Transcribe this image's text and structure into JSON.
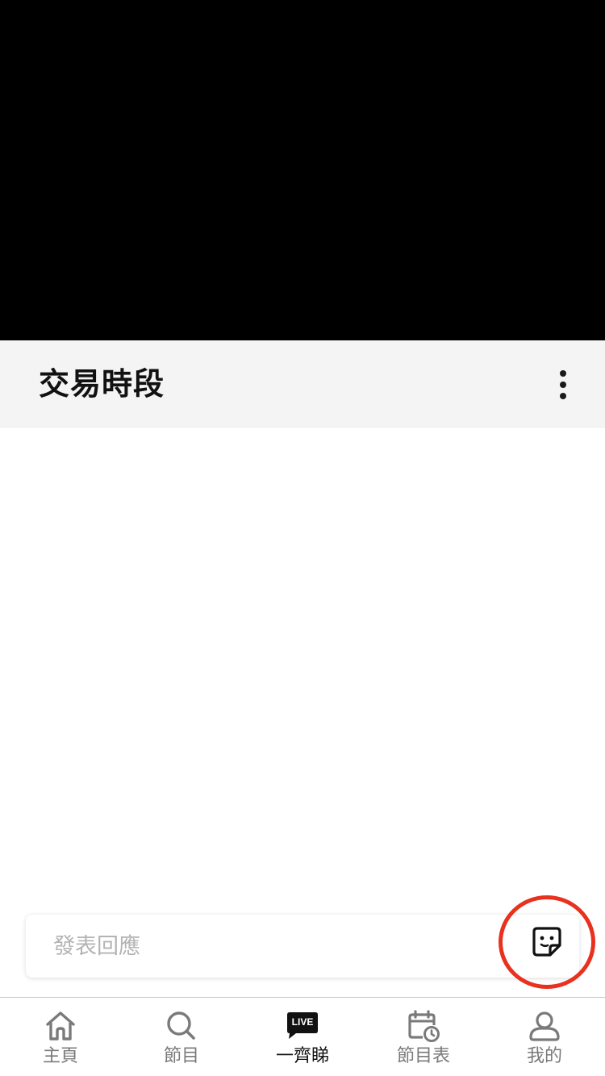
{
  "header": {
    "title": "交易時段"
  },
  "comment": {
    "placeholder": "發表回應"
  },
  "bottom_nav": {
    "items": [
      {
        "label": "主頁",
        "icon": "home-icon",
        "active": false
      },
      {
        "label": "節目",
        "icon": "search-icon",
        "active": false
      },
      {
        "label": "一齊睇",
        "icon": "live-icon",
        "badge": "LIVE",
        "active": true
      },
      {
        "label": "節目表",
        "icon": "calendar-clock-icon",
        "active": false
      },
      {
        "label": "我的",
        "icon": "profile-icon",
        "active": false
      }
    ]
  },
  "colors": {
    "highlight_ring": "#e8321f",
    "title_bar_bg": "#f4f4f4",
    "nav_inactive": "#7a7a7a",
    "nav_active": "#111111"
  }
}
